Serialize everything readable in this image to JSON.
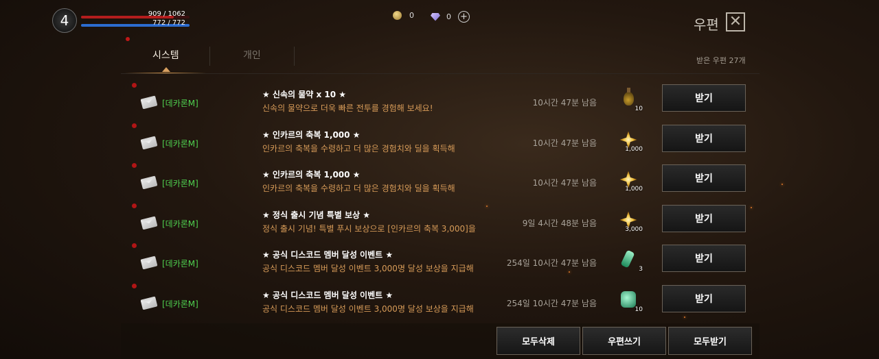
{
  "hud": {
    "level": "4",
    "hp_text": "909 / 1062",
    "mp_text": "772 / 772",
    "hp_ratio": 0.856,
    "mp_ratio": 1.0,
    "gold_amount": "0",
    "diamond_amount": "0"
  },
  "header": {
    "title": "우편",
    "close_icon": "x-icon"
  },
  "tabs": [
    {
      "label": "시스템",
      "active": true
    },
    {
      "label": "개인",
      "active": false
    }
  ],
  "mail_count": "받은 우편 27개",
  "mails": [
    {
      "sender": "[데카론M]",
      "subject": "★ 신속의 물약 x 10 ★",
      "desc": "신속의 물약으로 더욱 빠른 전투를 경험해 보세요!",
      "time": "10시간 47분 남음",
      "item_icon": "potion-icon",
      "item_qty": "10",
      "button": "받기"
    },
    {
      "sender": "[데카론M]",
      "subject": "★ 인카르의 축복 1,000 ★",
      "desc": "인카르의 축복을 수령하고 더 많은 경험치와 딜을 획득해",
      "time": "10시간 47분 남음",
      "item_icon": "blessing-icon",
      "item_qty": "1,000",
      "button": "받기"
    },
    {
      "sender": "[데카론M]",
      "subject": "★ 인카르의 축복 1,000 ★",
      "desc": "인카르의 축복을 수령하고 더 많은 경험치와 딜을 획득해",
      "time": "10시간 47분 남음",
      "item_icon": "blessing-icon",
      "item_qty": "1,000",
      "button": "받기"
    },
    {
      "sender": "[데카론M]",
      "subject": "★ 정식 출시 기념 특별 보상 ★",
      "desc": "정식 출시 기념! 특별 푸시 보상으로 [인카르의 축복 3,000]을",
      "time": "9일 4시간 48분 남음",
      "item_icon": "blessing-icon",
      "item_qty": "3,000",
      "button": "받기"
    },
    {
      "sender": "[데카론M]",
      "subject": "★ 공식 디스코드 멤버 달성 이벤트 ★",
      "desc": "공식 디스코드 멤버 달성 이벤트 3,000명 달성 보상을 지급해",
      "time": "254일 10시간 47분 남음",
      "item_icon": "vial-icon",
      "item_qty": "3",
      "button": "받기"
    },
    {
      "sender": "[데카론M]",
      "subject": "★ 공식 디스코드 멤버 달성 이벤트 ★",
      "desc": "공식 디스코드 멤버 달성 이벤트 3,000명 달성 보상을 지급해",
      "time": "254일 10시간 47분 남음",
      "item_icon": "jar-icon",
      "item_qty": "10",
      "button": "받기"
    }
  ],
  "footer": {
    "delete_all": "모두삭제",
    "write_mail": "우편쓰기",
    "receive_all": "모두받기"
  }
}
